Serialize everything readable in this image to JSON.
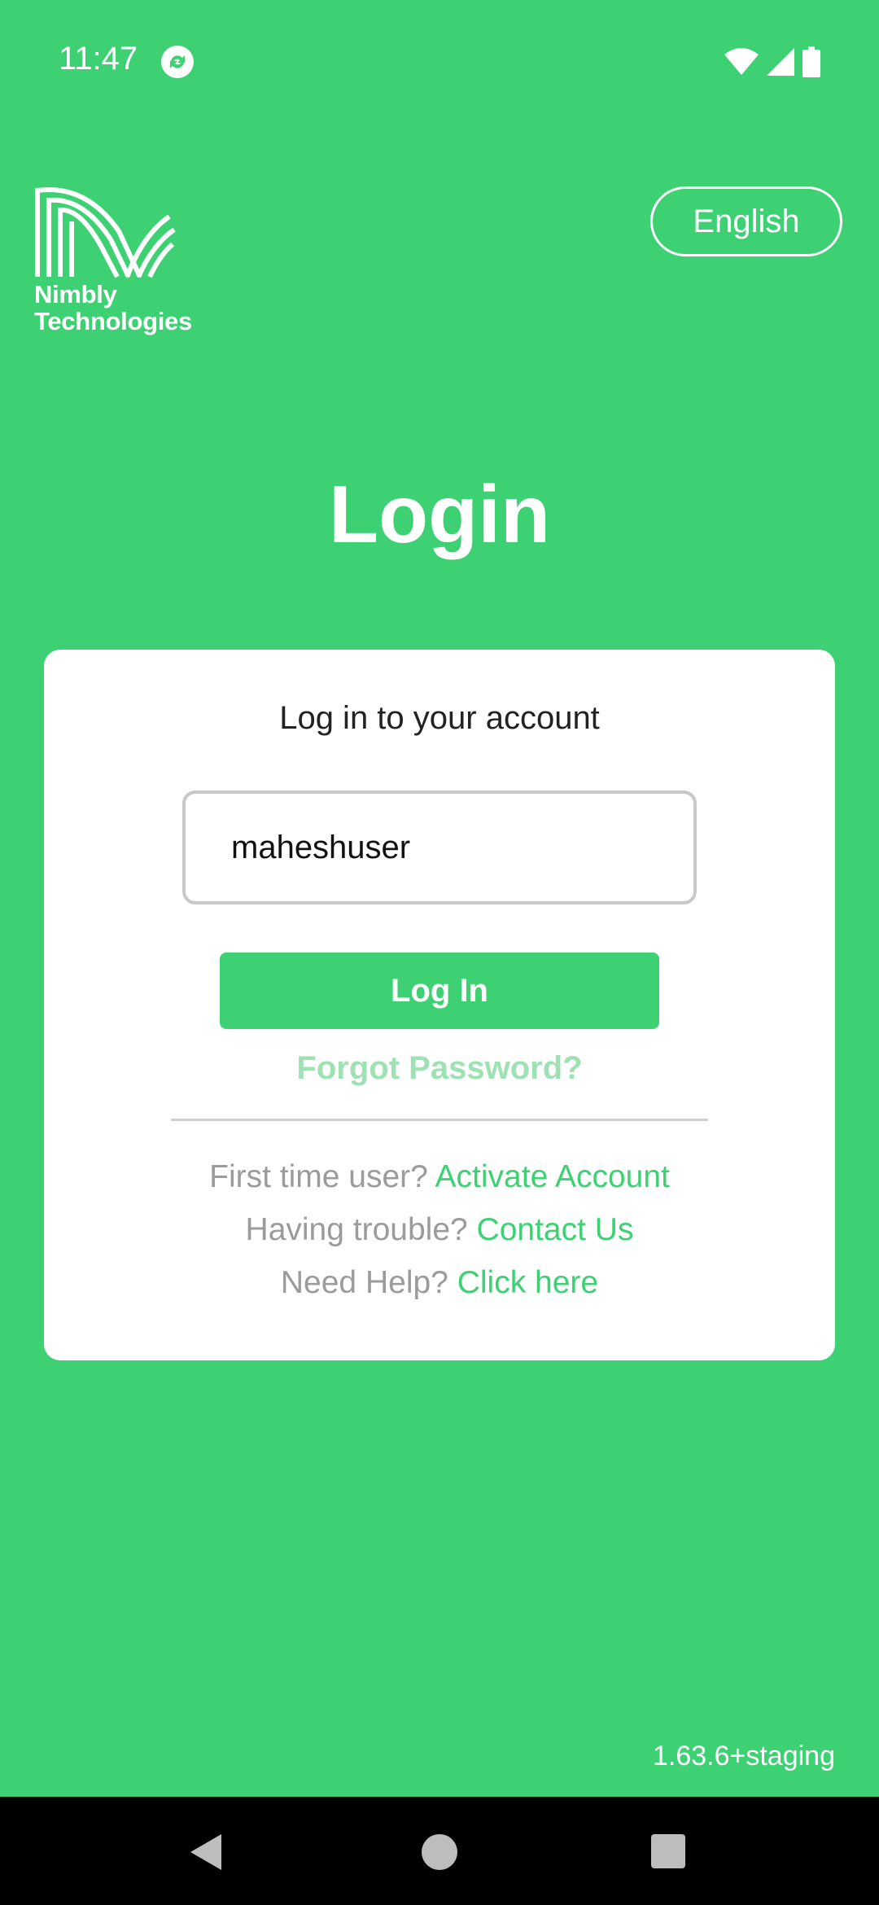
{
  "status_bar": {
    "time": "11:47",
    "icons": [
      "sync-icon",
      "wifi-icon",
      "signal-icon",
      "battery-icon"
    ]
  },
  "brand": {
    "line1": "Nimbly",
    "line2": "Technologies"
  },
  "language_button": "English",
  "page_title": "Login",
  "card": {
    "subtitle": "Log in to your account",
    "username_value": "maheshuser",
    "login_button": "Log In",
    "forgot_password": "Forgot Password?",
    "help": [
      {
        "prefix": "First time user? ",
        "link": "Activate Account"
      },
      {
        "prefix": "Having trouble? ",
        "link": "Contact Us"
      },
      {
        "prefix": "Need Help? ",
        "link": "Click here"
      }
    ]
  },
  "version": "1.63.6+staging",
  "colors": {
    "accent": "#3ed174",
    "card_bg": "#ffffff",
    "muted_text": "#9b9b9b",
    "forgot_link": "#9ee2b4"
  }
}
